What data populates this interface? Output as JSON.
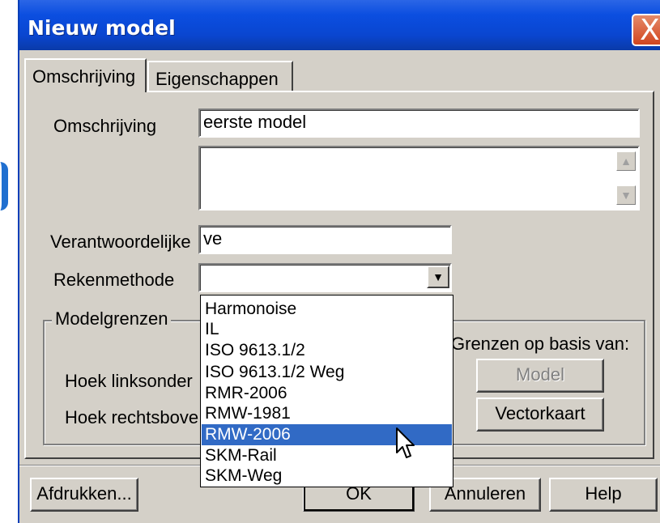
{
  "window": {
    "title": "Nieuw model",
    "close_glyph": "X"
  },
  "tabs": [
    {
      "label": "Omschrijving",
      "active": true
    },
    {
      "label": "Eigenschappen",
      "active": false
    }
  ],
  "form": {
    "omschrijving_label": "Omschrijving",
    "omschrijving_value": "eerste model",
    "memo_value": "",
    "verantwoordelijke_label": "Verantwoordelijke",
    "verantwoordelijke_value": "ve",
    "rekenmethode_label": "Rekenmethode",
    "rekenmethode_value": ""
  },
  "modelgrenzen": {
    "title": "Modelgrenzen",
    "hoek_linksonder_label": "Hoek linksonder",
    "hoek_rechtsboven_label": "Hoek rechtsbove",
    "grenzen_label": "Grenzen op basis van:",
    "model_button": "Model",
    "vectorkaart_button": "Vectorkaart"
  },
  "dropdown": {
    "options": [
      "Harmonoise",
      "IL",
      "ISO 9613.1/2",
      "ISO 9613.1/2 Weg",
      "RMR-2006",
      "RMW-1981",
      "RMW-2006",
      "SKM-Rail",
      "SKM-Weg"
    ],
    "highlighted": "RMW-2006"
  },
  "footer": {
    "afdrukken": "Afdrukken...",
    "ok": "OK",
    "annuleren": "Annuleren",
    "help": "Help"
  },
  "icons": {
    "close": "close-icon",
    "combo_arrow": "chevron-down-icon",
    "scroll_up": "scroll-up-icon",
    "scroll_down": "scroll-down-icon",
    "cursor": "mouse-pointer-icon"
  },
  "colors": {
    "titlebar": "#0a46d0",
    "selection": "#316ac5",
    "dialog_bg": "#d4d0c8",
    "close_button": "#d2451e"
  }
}
